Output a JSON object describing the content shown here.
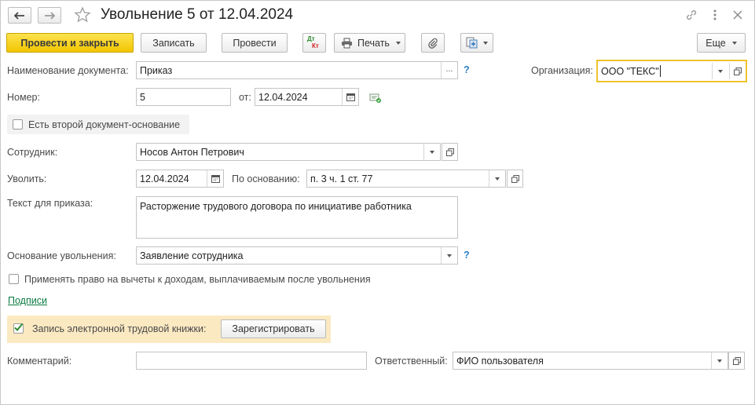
{
  "window": {
    "title": "Увольнение 5 от 12.04.2024"
  },
  "toolbar": {
    "post_close": "Провести и закрыть",
    "save": "Записать",
    "post": "Провести",
    "dtkt_top": "Дт",
    "dtkt_bottom": "Кт",
    "print": "Печать",
    "more": "Еще"
  },
  "form": {
    "doc_name_label": "Наименование документа:",
    "doc_name_value": "Приказ",
    "doc_name_btn": "...",
    "help": "?",
    "org_label": "Организация:",
    "org_value": "ООО \"ТЕКС\"",
    "number_label": "Номер:",
    "number_value": "5",
    "date_from_label": "от:",
    "date_value": "12.04.2024",
    "second_basis_label": "Есть второй документ-основание",
    "employee_label": "Сотрудник:",
    "employee_value": "Носов Антон Петрович",
    "dismiss_label": "Уволить:",
    "dismiss_date": "12.04.2024",
    "basis_label": "По основанию:",
    "basis_value": "п. 3 ч. 1 ст. 77",
    "order_text_label": "Текст для приказа:",
    "order_text_value": "Расторжение трудового договора по инициативе работника",
    "reason_label": "Основание увольнения:",
    "reason_value": "Заявление сотрудника",
    "deduction_label": "Применять право на вычеты к доходам, выплачиваемым после увольнения",
    "signatures_link": "Подписи",
    "etk_label": "Запись электронной трудовой книжки:",
    "etk_button": "Зарегистрировать",
    "comment_label": "Комментарий:",
    "comment_value": "",
    "responsible_label": "Ответственный:",
    "responsible_value": "ФИО пользователя"
  },
  "colors": {
    "primary_button": "#f2c500",
    "focus_border": "#f0c22c",
    "etk_panel": "#fbe9c2",
    "link": "#0a7a3f",
    "help": "#2b7fc3"
  }
}
